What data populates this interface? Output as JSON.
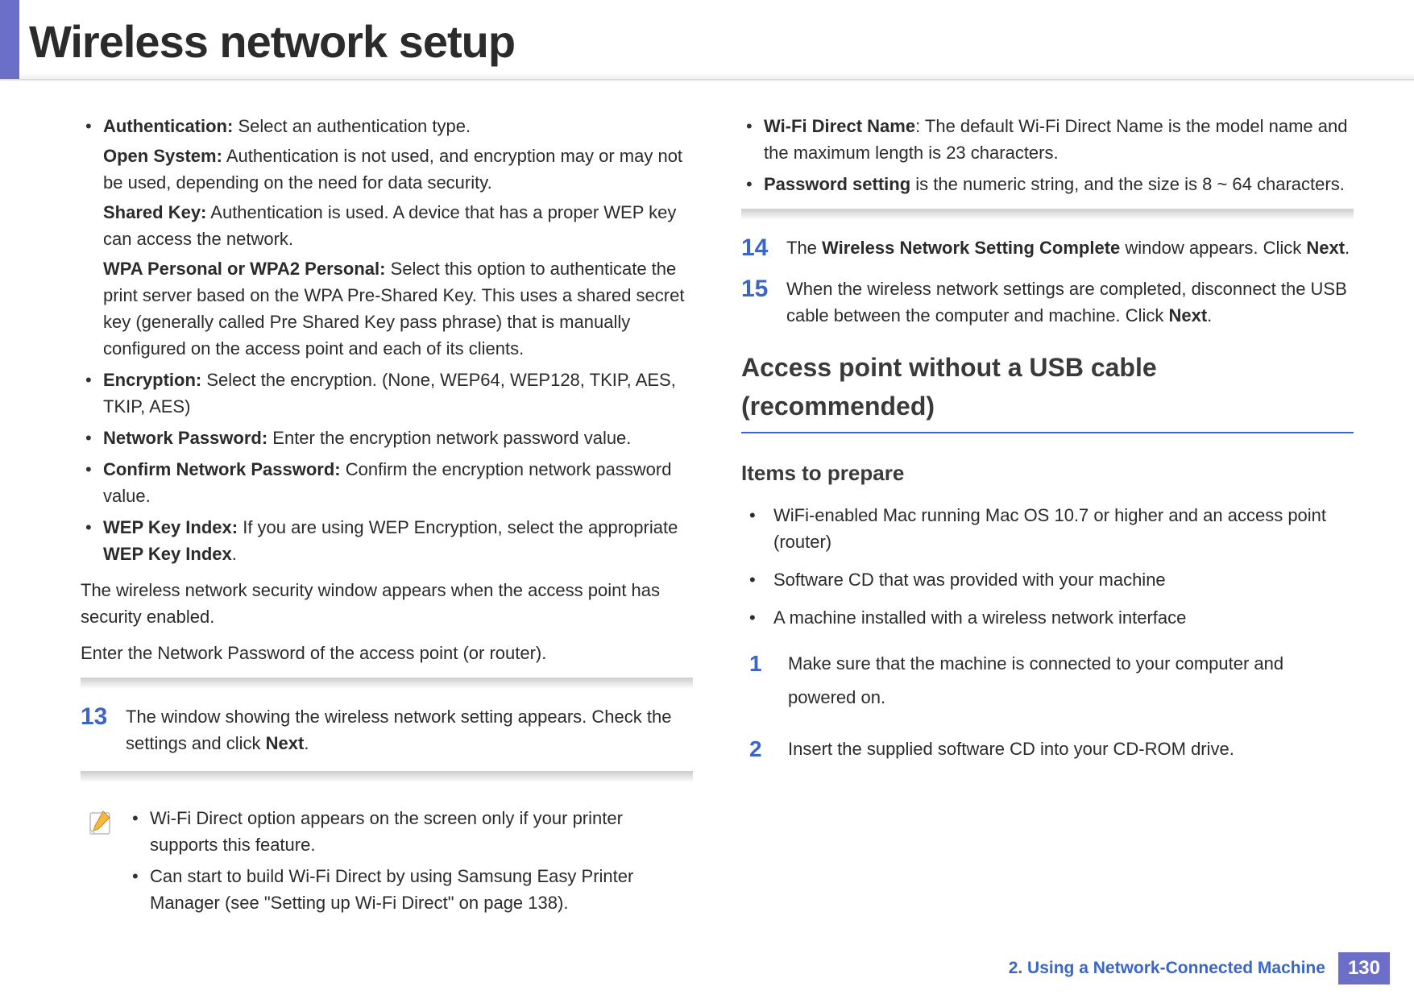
{
  "header": {
    "title": "Wireless network setup"
  },
  "left": {
    "bullets": [
      {
        "label": "Authentication:",
        "text": " Select an authentication type.",
        "subs": [
          {
            "label": "Open System:",
            "text": " Authentication is not used, and encryption may or may not be used, depending on the need for data security."
          },
          {
            "label": "Shared Key:",
            "text": " Authentication is used. A device that has a proper WEP key can access the network."
          },
          {
            "label": "WPA Personal or WPA2 Personal:",
            "text": " Select this option to authenticate the print server based on the WPA Pre-Shared Key. This uses a shared secret key (generally called Pre Shared Key pass phrase) that is manually configured on the access point and each of its clients."
          }
        ]
      },
      {
        "label": "Encryption:",
        "text": " Select the encryption. (None, WEP64, WEP128, TKIP, AES, TKIP, AES)"
      },
      {
        "label": "Network Password:",
        "text": " Enter the encryption network password value."
      },
      {
        "label": "Confirm Network Password:",
        "text": " Confirm the encryption network password value."
      },
      {
        "label": "WEP Key Index:",
        "text_pre": " If you are using WEP Encryption, select the appropriate ",
        "bold_tail": "WEP Key Index",
        "tail": "."
      }
    ],
    "para1": "The wireless network security window appears when the access point has security enabled.",
    "para2": "Enter the Network Password of the access point (or router).",
    "step13": {
      "num": "13",
      "text_pre": "The window showing the wireless network setting appears. Check the settings and click ",
      "bold": "Next",
      "tail": "."
    },
    "note": {
      "b1": "Wi-Fi Direct option appears on the screen only if your printer supports this feature.",
      "b2_pre": "Can start to build Wi-Fi Direct by using Samsung Easy Printer Manager (see ",
      "b2_link": "\"Setting up Wi-Fi Direct\" on page 138",
      "b2_tail": ")."
    }
  },
  "right": {
    "top_bullets": [
      {
        "label": "Wi-Fi Direct Name",
        "text": ": The default Wi-Fi Direct Name is the model name and the maximum length is 23 characters."
      },
      {
        "label": "Password setting",
        "text": " is the numeric string, and the size is 8 ~ 64 characters."
      }
    ],
    "step14": {
      "num": "14",
      "pre": "The ",
      "bold1": "Wireless Network Setting Complete",
      "mid": " window appears. Click ",
      "bold2": "Next",
      "tail": "."
    },
    "step15": {
      "num": "15",
      "pre": "When the wireless network settings are completed, disconnect the USB cable between the computer and machine. Click ",
      "bold": "Next",
      "tail": "."
    },
    "section_heading": "Access point without a USB cable (recommended)",
    "sub_heading": "Items to prepare",
    "prepare": [
      "WiFi-enabled Mac running Mac OS 10.7 or higher and an access point (router)",
      "Software CD that was provided with your machine",
      "A machine installed with a wireless network interface"
    ],
    "steps": [
      {
        "num": "1",
        "text": "Make sure that the machine is connected to your computer and powered on."
      },
      {
        "num": "2",
        "text": "Insert the supplied software CD into your CD-ROM drive."
      }
    ]
  },
  "footer": {
    "chapter": "2.  Using a Network-Connected Machine",
    "page": "130"
  }
}
